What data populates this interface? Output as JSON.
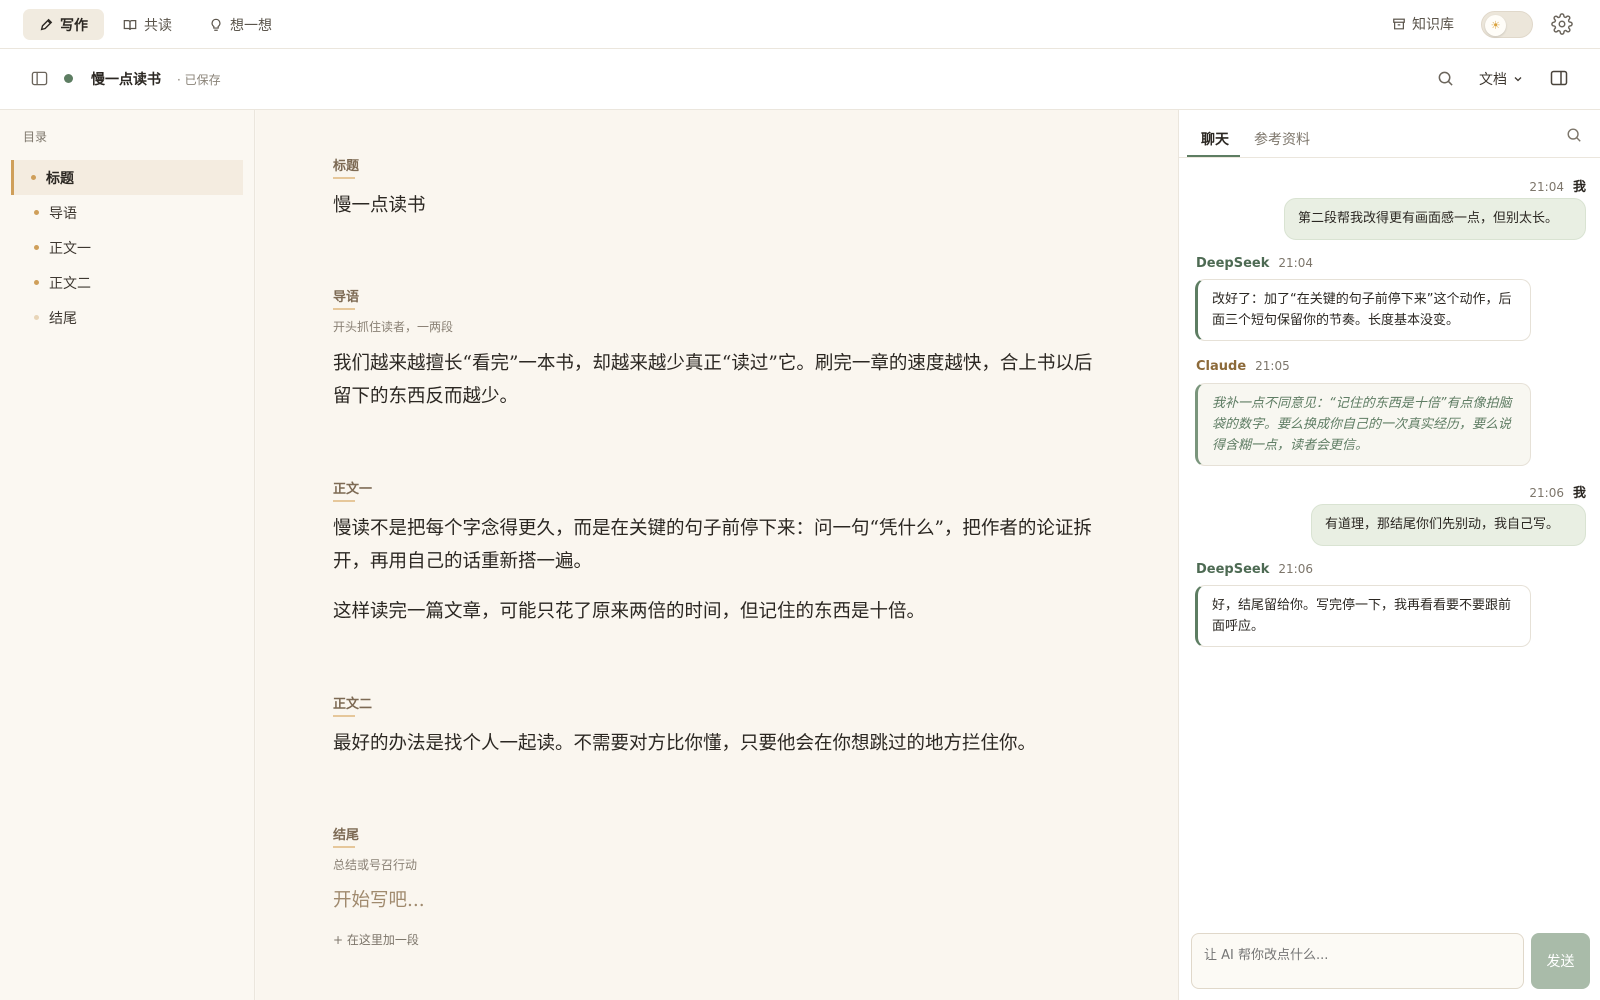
{
  "topbar": {
    "tabs": [
      {
        "label": "写作",
        "icon": "pencil-icon",
        "active": true
      },
      {
        "label": "共读",
        "icon": "book-icon",
        "active": false
      },
      {
        "label": "想一想",
        "icon": "lightbulb-icon",
        "active": false
      }
    ],
    "knowledge_base_label": "知识库",
    "theme_icon": "sun-icon",
    "settings_icon": "gear-icon"
  },
  "docbar": {
    "title": "慢一点读书",
    "save_state": "· 已保存",
    "mode_label": "文档"
  },
  "outline": {
    "label": "目录",
    "items": [
      {
        "label": "标题",
        "active": true
      },
      {
        "label": "导语"
      },
      {
        "label": "正文一"
      },
      {
        "label": "正文二"
      },
      {
        "label": "结尾",
        "empty": true
      }
    ]
  },
  "editor": {
    "sections": [
      {
        "label": "标题",
        "hint": "",
        "paragraphs": [
          "慢一点读书"
        ]
      },
      {
        "label": "导语",
        "hint": "开头抓住读者，一两段",
        "paragraphs": [
          "我们越来越擅长“看完”一本书，却越来越少真正“读过”它。刷完一章的速度越快，合上书以后留下的东西反而越少。"
        ]
      },
      {
        "label": "正文一",
        "hint": "",
        "paragraphs": [
          "慢读不是把每个字念得更久，而是在关键的句子前停下来：问一句“凭什么”，把作者的论证拆开，再用自己的话重新搭一遍。",
          "这样读完一篇文章，可能只花了原来两倍的时间，但记住的东西是十倍。"
        ]
      },
      {
        "label": "正文二",
        "hint": "",
        "paragraphs": [
          "最好的办法是找个人一起读。不需要对方比你懂，只要他会在你想跳过的地方拦住你。"
        ]
      },
      {
        "label": "结尾",
        "hint": "总结或号召行动",
        "placeholder": "开始写吧..."
      }
    ],
    "add_paragraph": "+ 在这里加一段"
  },
  "chat": {
    "tabs": [
      "聊天",
      "参考资料"
    ],
    "messages": [
      {
        "from": "我",
        "time": "21:04",
        "text": "第二段帮我改得更有画面感一点，但别太长。"
      },
      {
        "from": "DeepSeek",
        "time": "21:04",
        "text": "改好了：加了“在关键的句子前停下来”这个动作，后面三个短句保留你的节奏。长度基本没变。"
      },
      {
        "from": "Claude",
        "time": "21:05",
        "text": "我补一点不同意见：“记住的东西是十倍”有点像拍脑袋的数字。要么换成你自己的一次真实经历，要么说得含糊一点，读者会更信。"
      },
      {
        "from": "我",
        "time": "21:06",
        "text": "有道理，那结尾你们先别动，我自己写。"
      },
      {
        "from": "DeepSeek",
        "time": "21:06",
        "text": "好，结尾留给你。写完停一下，我再看看要不要跟前面呼应。"
      }
    ],
    "input_placeholder": "让 AI 帮你改点什么...",
    "send_label": "发送"
  },
  "colors": {
    "accent_green": "#5d7d62",
    "accent_gold": "#cf9f5a",
    "background": "#fbf8f2"
  }
}
